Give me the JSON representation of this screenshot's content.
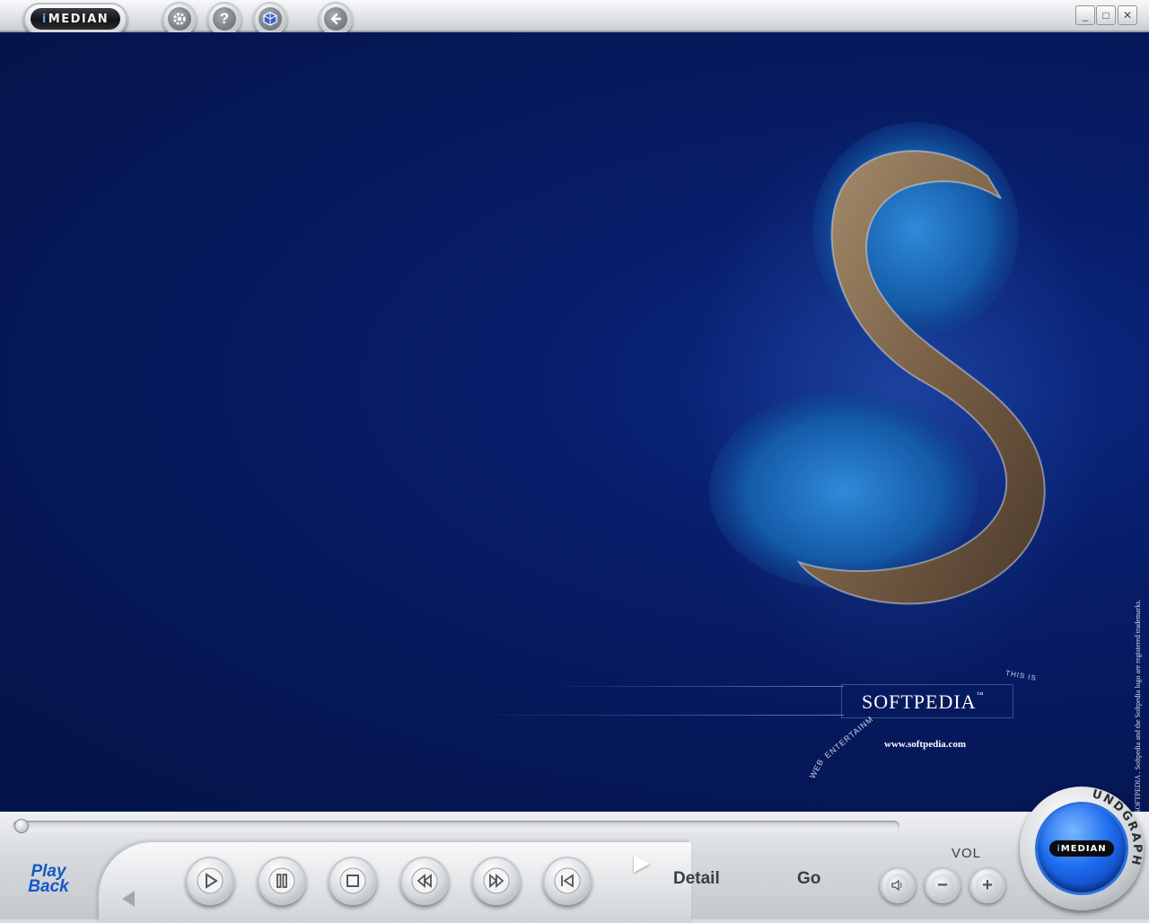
{
  "app": {
    "logo_prefix": "i",
    "logo_text": "MEDIAN"
  },
  "toolbar": {
    "settings_icon": "gear-icon",
    "help_label": "?",
    "library_icon": "cube-icon",
    "back_icon": "arrow-left-icon"
  },
  "window_controls": {
    "minimize": "_",
    "maximize": "□",
    "close": "✕"
  },
  "display": {
    "brand": "SOFTPEDIA",
    "trademark": "™",
    "url": "www.softpedia.com",
    "arc_text_1": "WEB",
    "arc_text_2": "ENTERTAINM",
    "arc_text_3": "THIS IS",
    "vertical_notice": "SOFTPEDIA . Softpedia and the Softpedia logo are registered trademarks."
  },
  "player": {
    "playback_label_1": "Play",
    "playback_label_2": "Back",
    "seek_progress": 0.0,
    "detail_label": "Detail",
    "go_label": "Go",
    "vol_label": "VOL",
    "mute_icon": "speaker-icon",
    "vol_down": "−",
    "vol_up": "+",
    "orb_logo_prefix": "i",
    "orb_logo_text": "MEDIAN",
    "orb_ring_text": "UNDGRAPH"
  },
  "colors": {
    "display_bg": "#06185a",
    "accent_blue": "#1657c8",
    "orb_blue": "#1f6df0"
  }
}
